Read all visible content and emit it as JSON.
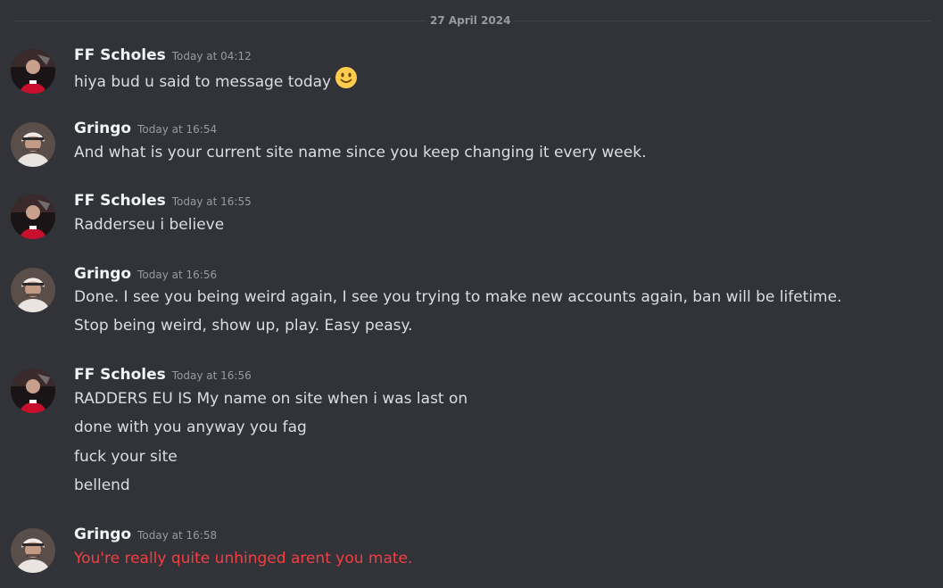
{
  "date_divider": "27 April 2024",
  "messages": [
    {
      "author": "FF Scholes",
      "time": "Today at 04:12",
      "avatar": "red-football-avatar",
      "lines": [
        "hiya bud u said to message today"
      ],
      "emoji": "slightly-smiling-face-emoji"
    },
    {
      "author": "Gringo",
      "time": "Today at 16:54",
      "avatar": "man-in-headscarf-avatar",
      "lines": [
        "And what is your current site name since you keep changing it every week."
      ]
    },
    {
      "author": "FF Scholes",
      "time": "Today at 16:55",
      "avatar": "red-football-avatar",
      "lines": [
        "Radderseu i believe"
      ]
    },
    {
      "author": "Gringo",
      "time": "Today at 16:56",
      "avatar": "man-in-headscarf-avatar",
      "lines": [
        "Done. I see you being weird again, I see you trying to make new accounts again, ban will be lifetime.",
        "Stop being weird, show up, play. Easy peasy."
      ]
    },
    {
      "author": "FF Scholes",
      "time": "Today at 16:56",
      "avatar": "red-football-avatar",
      "lines": [
        "RADDERS EU IS My name on site when i was last on",
        "done with you anyway you fag",
        "fuck your site",
        "bellend"
      ]
    },
    {
      "author": "Gringo",
      "time": "Today at 16:58",
      "avatar": "man-in-headscarf-avatar",
      "lines": [
        "You're really quite unhinged arent you mate."
      ],
      "line_color": "#f23f43"
    }
  ],
  "colors": {
    "background": "#313338",
    "username": "#f2f3f5",
    "message_text": "#dbdee1",
    "timestamp": "#949ba4",
    "highlight_text": "#f23f43"
  }
}
